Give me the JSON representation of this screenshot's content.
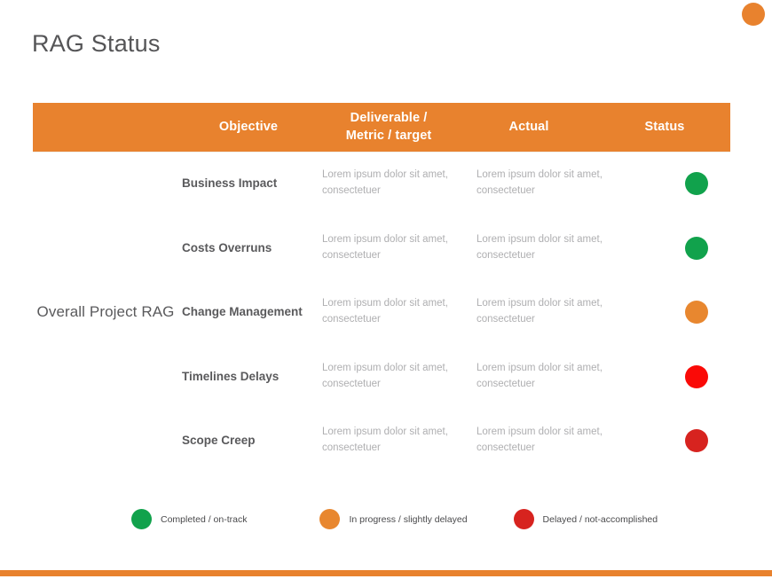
{
  "slide": {
    "title": "RAG Status",
    "accent_color": "#E8822E"
  },
  "table": {
    "row_label": "Overall Project\nRAG",
    "headers": {
      "rag": "",
      "objective": "Objective",
      "deliverable_line1": "Deliverable /",
      "deliverable_line2": "Metric / target",
      "actual": "Actual",
      "status": "Status"
    },
    "rows": [
      {
        "objective": "Business Impact",
        "deliverable": "Lorem ipsum dolor sit amet, consectetuer",
        "actual": "Lorem ipsum dolor sit amet, consectetuer",
        "status": "green",
        "status_color": "#11A24C"
      },
      {
        "objective": "Costs Overruns",
        "deliverable": "Lorem ipsum dolor sit amet, consectetuer",
        "actual": "Lorem ipsum dolor sit amet, consectetuer",
        "status": "green",
        "status_color": "#11A24C"
      },
      {
        "objective": "Change Management",
        "deliverable": "Lorem ipsum dolor sit amet, consectetuer",
        "actual": "Lorem ipsum dolor sit amet, consectetuer",
        "status": "amber",
        "status_color": "#E8872F"
      },
      {
        "objective": "Timelines Delays",
        "deliverable": "Lorem ipsum dolor sit amet, consectetuer",
        "actual": "Lorem ipsum dolor sit amet, consectetuer",
        "status": "red",
        "status_color": "#FA0A07"
      },
      {
        "objective": "Scope Creep",
        "deliverable": "Lorem ipsum dolor sit amet, consectetuer",
        "actual": "Lorem ipsum dolor sit amet, consectetuer",
        "status": "red",
        "status_color": "#D7231F"
      }
    ]
  },
  "legend": {
    "items": [
      {
        "label": "Completed / on-track",
        "color": "#11A24C",
        "key": "green"
      },
      {
        "label": "In progress / slightly delayed",
        "color": "#E8872F",
        "key": "amber"
      },
      {
        "label": "Delayed / not-accomplished",
        "color": "#D7231F",
        "key": "red"
      }
    ]
  }
}
